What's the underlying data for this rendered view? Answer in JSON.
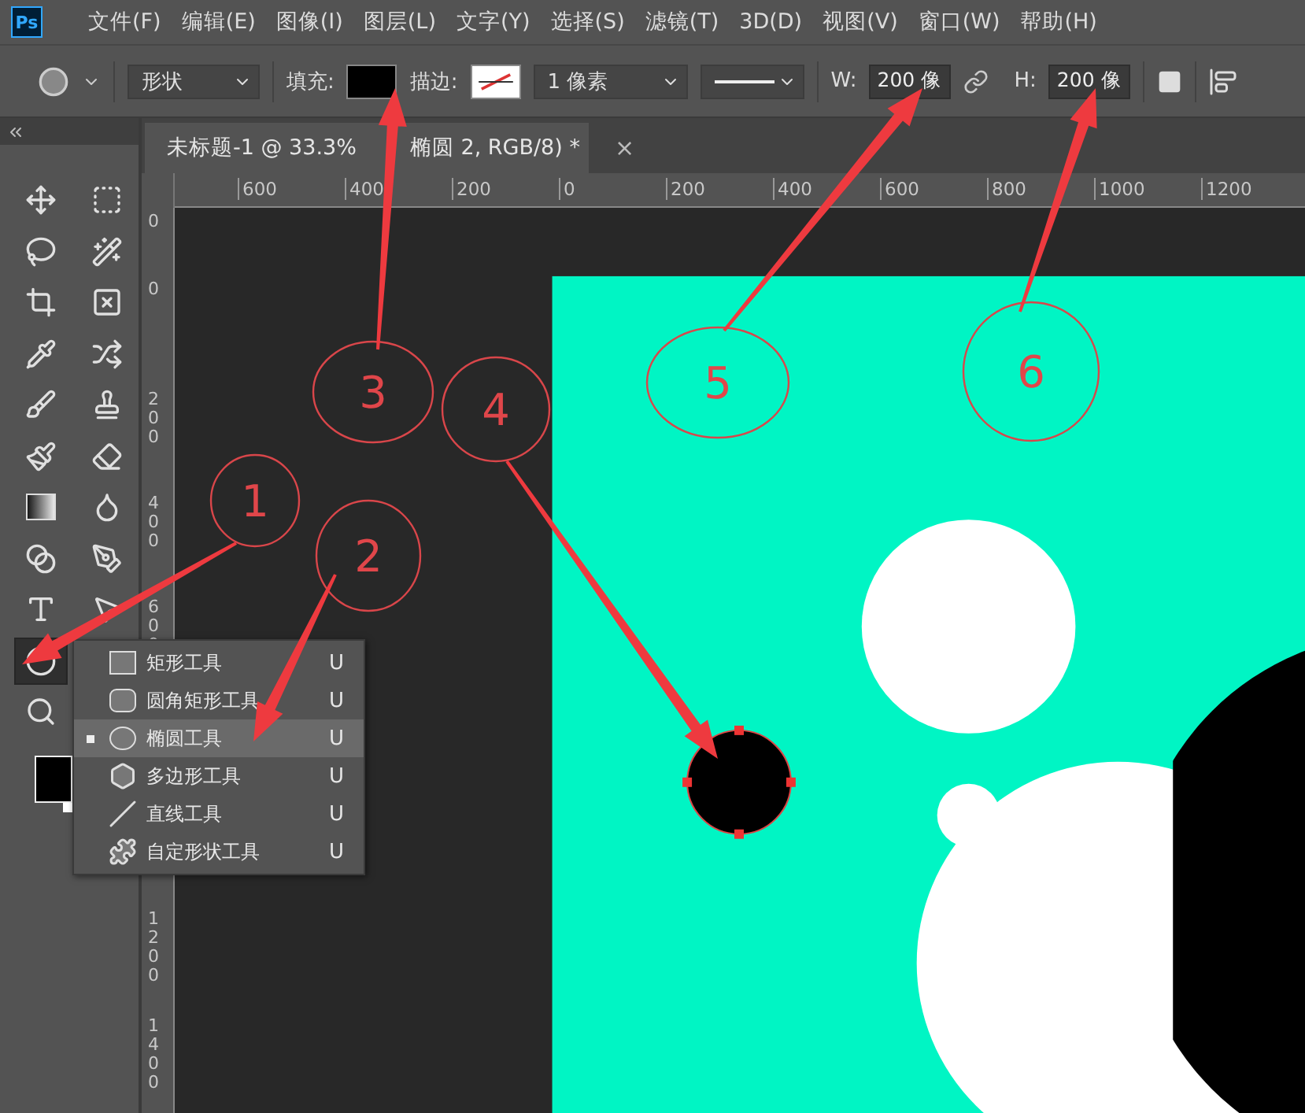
{
  "logo": "Ps",
  "menu": [
    "文件(F)",
    "编辑(E)",
    "图像(I)",
    "图层(L)",
    "文字(Y)",
    "选择(S)",
    "滤镜(T)",
    "3D(D)",
    "视图(V)",
    "窗口(W)",
    "帮助(H)"
  ],
  "options": {
    "shape_mode": "形状",
    "fill_label": "填充:",
    "stroke_label": "描边:",
    "stroke_width": "1 像素",
    "w_label": "W:",
    "w_value": "200 像",
    "h_label": "H:",
    "h_value": "200 像"
  },
  "document_tab": {
    "title_parts": [
      "未标题-1 @ 33.3%",
      "椭圆 2, RGB/8) *"
    ],
    "close": "×"
  },
  "ruler_h": [
    "600",
    "400",
    "200",
    "0",
    "200",
    "400",
    "600",
    "800",
    "1000",
    "1200"
  ],
  "ruler_v": [
    "0",
    "0",
    "200",
    "400",
    "600",
    "1200",
    "1400"
  ],
  "tools": [
    {
      "kind": "move",
      "selected": false
    },
    {
      "kind": "marquee",
      "selected": false
    },
    {
      "kind": "lasso",
      "selected": false
    },
    {
      "kind": "quick-select",
      "selected": false
    },
    {
      "kind": "crop",
      "selected": false
    },
    {
      "kind": "frame",
      "selected": false
    },
    {
      "kind": "eyedropper",
      "selected": false
    },
    {
      "kind": "patch",
      "selected": false
    },
    {
      "kind": "brush",
      "selected": false
    },
    {
      "kind": "stamp",
      "selected": false
    },
    {
      "kind": "history-brush",
      "selected": false
    },
    {
      "kind": "eraser",
      "selected": false
    },
    {
      "kind": "gradient",
      "selected": false
    },
    {
      "kind": "smudge",
      "selected": false
    },
    {
      "kind": "dodge",
      "selected": false
    },
    {
      "kind": "pen",
      "selected": false
    },
    {
      "kind": "type",
      "selected": false
    },
    {
      "kind": "path-select",
      "selected": false
    },
    {
      "kind": "ellipse",
      "selected": true
    },
    {
      "kind": "zoom",
      "selected": false
    }
  ],
  "shape_menu": [
    {
      "kind": "rectangle",
      "label": "矩形工具",
      "shortcut": "U",
      "selected": false
    },
    {
      "kind": "rounded",
      "label": "圆角矩形工具",
      "shortcut": "U",
      "selected": false
    },
    {
      "kind": "ellipse",
      "label": "椭圆工具",
      "shortcut": "U",
      "selected": true
    },
    {
      "kind": "polygon",
      "label": "多边形工具",
      "shortcut": "U",
      "selected": false
    },
    {
      "kind": "line",
      "label": "直线工具",
      "shortcut": "U",
      "selected": false
    },
    {
      "kind": "custom",
      "label": "自定形状工具",
      "shortcut": "U",
      "selected": false
    }
  ],
  "annotations": [
    "1",
    "2",
    "3",
    "4",
    "5",
    "6"
  ]
}
